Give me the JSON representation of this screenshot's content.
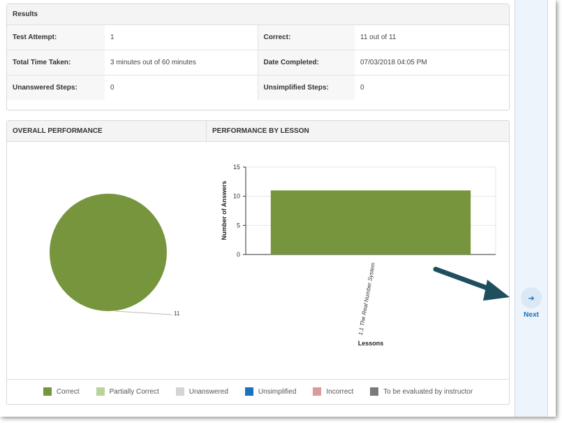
{
  "results": {
    "title": "Results",
    "rows": [
      {
        "label1": "Test Attempt:",
        "value1": "1",
        "label2": "Correct:",
        "value2": "11 out of 11"
      },
      {
        "label1": "Total Time Taken:",
        "value1": "3 minutes out of 60 minutes",
        "label2": "Date Completed:",
        "value2": "07/03/2018 04:05 PM"
      },
      {
        "label1": "Unanswered Steps:",
        "value1": "0",
        "label2": "Unsimplified Steps:",
        "value2": "0"
      }
    ]
  },
  "performance": {
    "overall_title": "OVERALL PERFORMANCE",
    "lesson_title": "PERFORMANCE BY LESSON"
  },
  "chart_data": [
    {
      "type": "pie",
      "title": "",
      "labels": [
        "Correct"
      ],
      "values": [
        11
      ],
      "data_labels": [
        "11"
      ],
      "colors": [
        "#77953d"
      ]
    },
    {
      "type": "bar",
      "title": "",
      "categories": [
        "1.1 The Real Number System"
      ],
      "values": [
        11
      ],
      "xlabel": "Lessons",
      "ylabel": "Number of Answers",
      "ylim": [
        0,
        15
      ],
      "yticks": [
        0,
        5,
        10,
        15
      ],
      "grid": true,
      "color": "#77953d"
    }
  ],
  "legend": [
    {
      "label": "Correct",
      "color": "#77953d"
    },
    {
      "label": "Partially Correct",
      "color": "#b8d39b"
    },
    {
      "label": "Unanswered",
      "color": "#d4d4d4"
    },
    {
      "label": "Unsimplified",
      "color": "#1a72bd"
    },
    {
      "label": "Incorrect",
      "color": "#d99b9b"
    },
    {
      "label": "To be evaluated by instructor",
      "color": "#7a7a7a"
    }
  ],
  "sidebar": {
    "next_label": "Next",
    "next_icon": "arrow-right-icon"
  },
  "colors": {
    "accent": "#1c6fb5",
    "annotation_arrow": "#1f4f5e"
  }
}
